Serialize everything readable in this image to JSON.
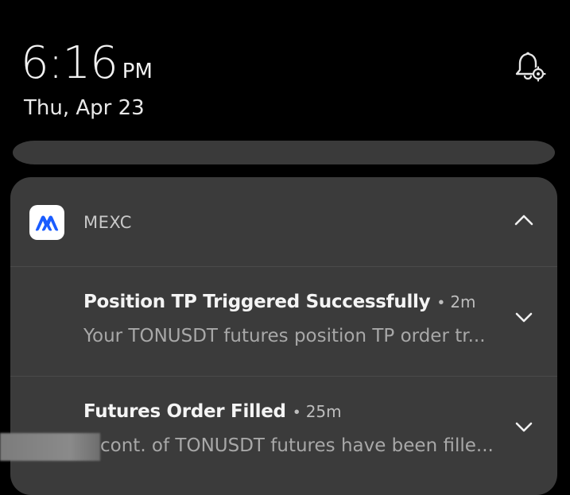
{
  "lockscreen": {
    "time": "6:16",
    "ampm": "PM",
    "date": "Thu, Apr 23",
    "bell_icon": "bell-settings-icon"
  },
  "notification_group": {
    "app_name": "MEXC",
    "app_icon": "mexc-logo-icon",
    "app_icon_color": "#1a5cff",
    "collapse_icon": "chevron-up-icon",
    "notifications": [
      {
        "title": "Position TP Triggered Successfully",
        "separator": "•",
        "time": "2m",
        "body": "Your TONUSDT futures position TP order tr...",
        "expand_icon": "chevron-down-icon"
      },
      {
        "title": "Futures Order Filled",
        "separator": "•",
        "time": "25m",
        "body": "cont. of TONUSDT futures have been fille...",
        "expand_icon": "chevron-down-icon"
      }
    ]
  },
  "colors": {
    "background": "#000000",
    "card": "#3b3b3b",
    "title_text": "#f4f4f4",
    "body_text": "#a8a8a8"
  }
}
